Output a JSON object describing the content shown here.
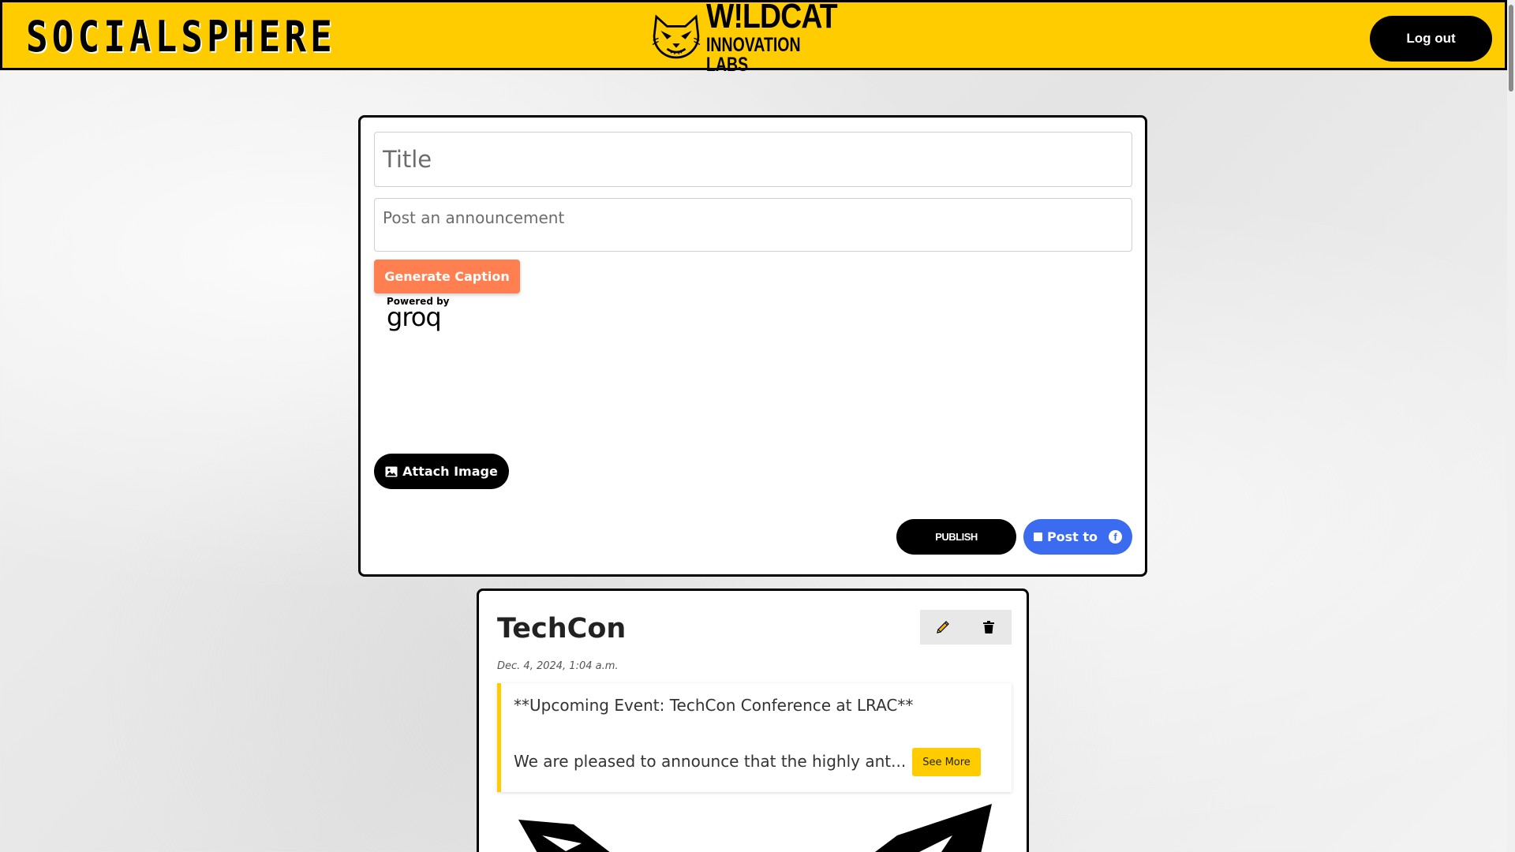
{
  "header": {
    "brand": "SOCIALSPHERE",
    "logo_line1": "W!LDCAT",
    "logo_line2": "INNOVATION LABS",
    "logout_label": "Log out",
    "bg_color": "#ffcc00"
  },
  "composer": {
    "title_placeholder": "Title",
    "announcement_placeholder": "Post an announcement",
    "generate_caption_label": "Generate Caption",
    "powered_by": "Powered by",
    "groq_logo": "groq",
    "attach_image_label": "Attach Image",
    "publish_label": "PUBLISH",
    "post_to_label": "Post to",
    "icons": {
      "attach": "image-icon",
      "post_to_checkbox": "checkbox-icon",
      "facebook": "facebook-icon"
    }
  },
  "post": {
    "title": "TechCon",
    "date": "Dec. 4, 2024, 1:04 a.m.",
    "body_line1": "**Upcoming Event: TechCon Conference at LRAC**",
    "body_line2": "We are pleased to announce that the highly ant...",
    "see_more_label": "See More",
    "icons": {
      "edit": "pencil-icon",
      "delete": "trash-icon"
    }
  },
  "colors": {
    "accent_yellow": "#ffcc00",
    "caption_button": "#ff7f50",
    "facebook_blue": "#3b6cf0"
  }
}
